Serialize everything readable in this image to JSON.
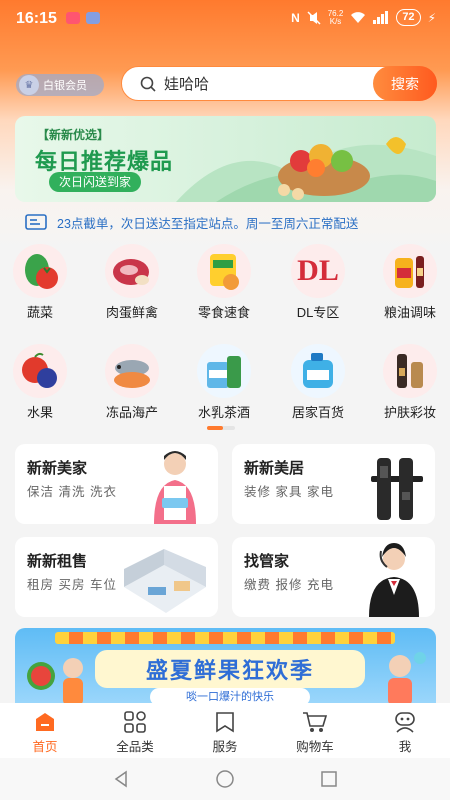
{
  "status_bar": {
    "time": "16:15",
    "network_speed_value": "76.2",
    "network_speed_unit": "K/s",
    "battery": "72"
  },
  "header": {
    "member_badge": "白银会员",
    "search_value": "娃哈哈",
    "search_button": "搜索"
  },
  "banner": {
    "tag": "【新新优选】",
    "title": "每日推荐爆品",
    "subtitle": "次日闪送到家"
  },
  "notice": {
    "text": "23点截单，次日送达至指定站点。周一至周六正常配送"
  },
  "categories": [
    {
      "label": "蔬菜",
      "icon": "vegetable-icon"
    },
    {
      "label": "肉蛋鲜禽",
      "icon": "meat-icon"
    },
    {
      "label": "零食速食",
      "icon": "snack-icon"
    },
    {
      "label": "DL专区",
      "icon": "dl-logo-icon",
      "logo_text": "DL"
    },
    {
      "label": "粮油调味",
      "icon": "oil-icon"
    },
    {
      "label": "水果",
      "icon": "fruit-icon"
    },
    {
      "label": "冻品海产",
      "icon": "seafood-icon"
    },
    {
      "label": "水乳茶酒",
      "icon": "drinks-icon"
    },
    {
      "label": "居家百货",
      "icon": "household-icon"
    },
    {
      "label": "护肤彩妆",
      "icon": "cosmetics-icon"
    }
  ],
  "service_cards": [
    {
      "title": "新新美家",
      "subtitle": "保洁 清洗 洗衣",
      "art": "housekeeper-icon"
    },
    {
      "title": "新新美居",
      "subtitle": "装修 家具 家电",
      "art": "smart-lock-icon"
    },
    {
      "title": "新新租售",
      "subtitle": "租房 买房 车位",
      "art": "room-icon"
    },
    {
      "title": "找管家",
      "subtitle": "缴费 报修 充电",
      "art": "butler-icon"
    }
  ],
  "promo": {
    "title": "盛夏鲜果狂欢季",
    "subtitle": "啖一口爆汁的快乐"
  },
  "tabbar": [
    {
      "label": "首页",
      "icon": "home-icon",
      "active": true
    },
    {
      "label": "全品类",
      "icon": "categories-icon"
    },
    {
      "label": "服务",
      "icon": "service-icon"
    },
    {
      "label": "购物车",
      "icon": "cart-icon"
    },
    {
      "label": "我",
      "icon": "profile-icon"
    }
  ],
  "colors": {
    "accent": "#ff6a21",
    "banner_green": "#1f9a4f",
    "notice_blue": "#2a6fc4"
  }
}
